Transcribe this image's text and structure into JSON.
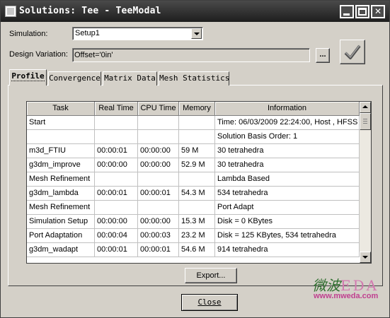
{
  "window": {
    "title": "Solutions: Tee - TeeModal",
    "controls": {
      "minimize_icon": "minimize-icon",
      "maximize_icon": "maximize-icon",
      "close_icon": "close-icon",
      "close_glyph": "✕"
    }
  },
  "form": {
    "simulation_label": "Simulation:",
    "simulation_value": "Setup1",
    "design_variation_label": "Design Variation:",
    "design_variation_value": "Offset='0in'",
    "browse_label": "...",
    "apply_icon": "checkmark-icon"
  },
  "tabs": [
    {
      "label": "Profile",
      "active": true
    },
    {
      "label": "Convergence",
      "active": false
    },
    {
      "label": "Matrix Data",
      "active": false
    },
    {
      "label": "Mesh Statistics",
      "active": false
    }
  ],
  "profile_table": {
    "columns": [
      "Task",
      "Real Time",
      "CPU Time",
      "Memory",
      "Information"
    ],
    "rows": [
      [
        "Start",
        "",
        "",
        "",
        "Time:  06/03/2009 22:24:00, Host , HFSS"
      ],
      [
        "",
        "",
        "",
        "",
        "Solution Basis Order: 1"
      ],
      [
        "m3d_FTIU",
        "00:00:01",
        "00:00:00",
        "59 M",
        "30 tetrahedra"
      ],
      [
        "g3dm_improve",
        "00:00:00",
        "00:00:00",
        "52.9 M",
        "30 tetrahedra"
      ],
      [
        "Mesh Refinement",
        "",
        "",
        "",
        "Lambda Based"
      ],
      [
        "g3dm_lambda",
        "00:00:01",
        "00:00:01",
        "54.3 M",
        "534 tetrahedra"
      ],
      [
        "Mesh Refinement",
        "",
        "",
        "",
        "Port Adapt"
      ],
      [
        "Simulation Setup",
        "00:00:00",
        "00:00:00",
        "15.3 M",
        "Disk = 0 KBytes"
      ],
      [
        "Port Adaptation",
        "00:00:04",
        "00:00:03",
        "23.2 M",
        "Disk = 125 KBytes, 534 tetrahedra"
      ],
      [
        "g3dm_wadapt",
        "00:00:01",
        "00:00:01",
        "54.6 M",
        "914 tetrahedra"
      ]
    ]
  },
  "buttons": {
    "export": "Export...",
    "close": "Close"
  },
  "watermark": {
    "chinese": "微波",
    "brand": "EDA",
    "url": "www.mweda.com"
  }
}
